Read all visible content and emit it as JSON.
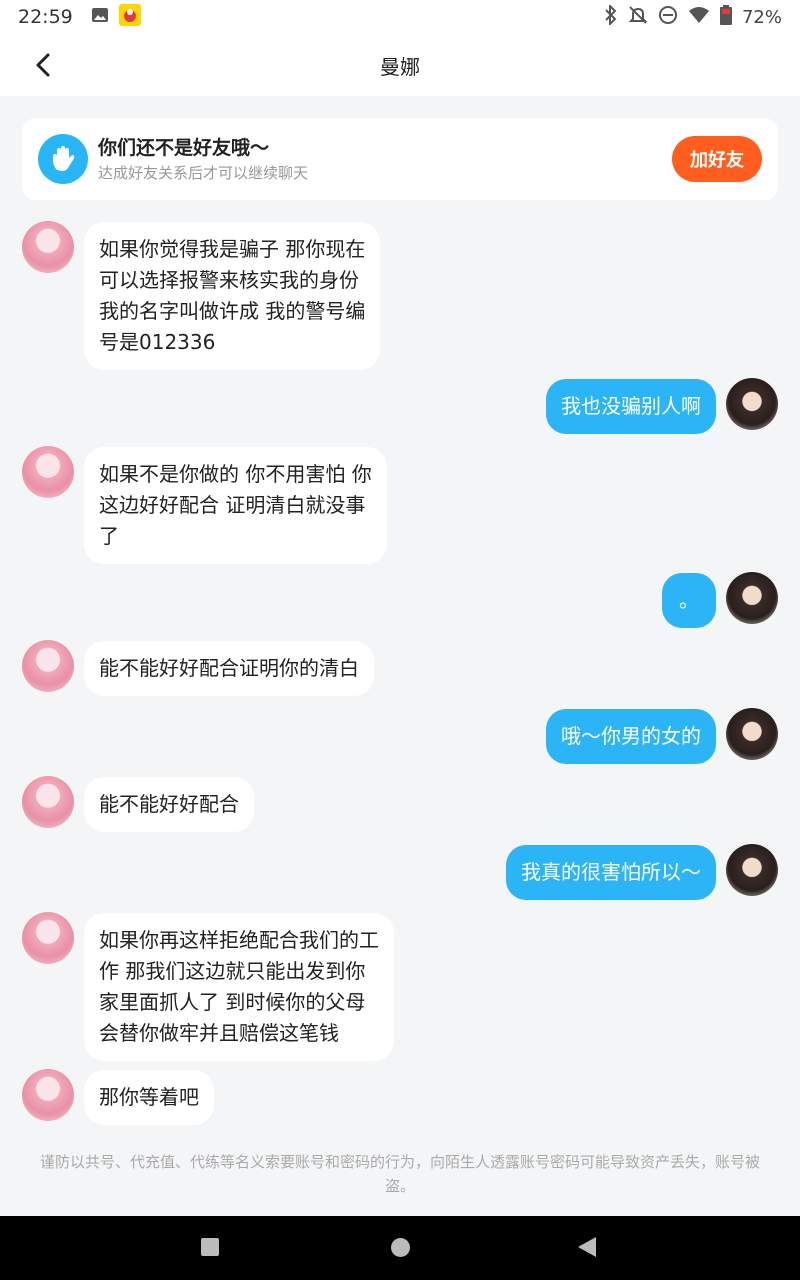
{
  "status_bar": {
    "time": "22:59",
    "battery": "72%",
    "icons": [
      "image-icon",
      "app-badge-icon",
      "bluetooth-icon",
      "bell-off-icon",
      "dnd-icon",
      "wifi-icon",
      "battery-icon"
    ]
  },
  "header": {
    "title": "曼娜"
  },
  "friend_card": {
    "title": "你们还不是好友哦～",
    "subtitle": "达成好友关系后才可以继续聊天",
    "button_label": "加好友",
    "button_color": "#ff5e1f"
  },
  "messages": [
    {
      "side": "left",
      "text": "如果你觉得我是骗子 那你现在\n可以选择报警来核实我的身份\n我的名字叫做许成 我的警号编\n号是012336"
    },
    {
      "side": "right",
      "text": "我也没骗别人啊"
    },
    {
      "side": "left",
      "text": "如果不是你做的 你不用害怕 你\n这边好好配合 证明清白就没事\n了"
    },
    {
      "side": "right",
      "text": "。"
    },
    {
      "side": "left",
      "text": "能不能好好配合证明你的清白"
    },
    {
      "side": "right",
      "text": "哦～你男的女的"
    },
    {
      "side": "left",
      "text": "能不能好好配合"
    },
    {
      "side": "right",
      "text": "我真的很害怕所以～"
    },
    {
      "side": "left",
      "text": "如果你再这样拒绝配合我们的工\n作 那我们这边就只能出发到你\n家里面抓人了 到时候你的父母\n会替你做牢并且赔偿这笔钱"
    },
    {
      "side": "left",
      "text": "那你等着吧"
    }
  ],
  "notice": "谨防以共号、代充值、代练等名义索要账号和密码的行为，向陌生人透露账号密码可能导致资产丢失，账号被盗。",
  "colors": {
    "accent_blue": "#2bb5f6",
    "background": "#f4f5f7"
  }
}
